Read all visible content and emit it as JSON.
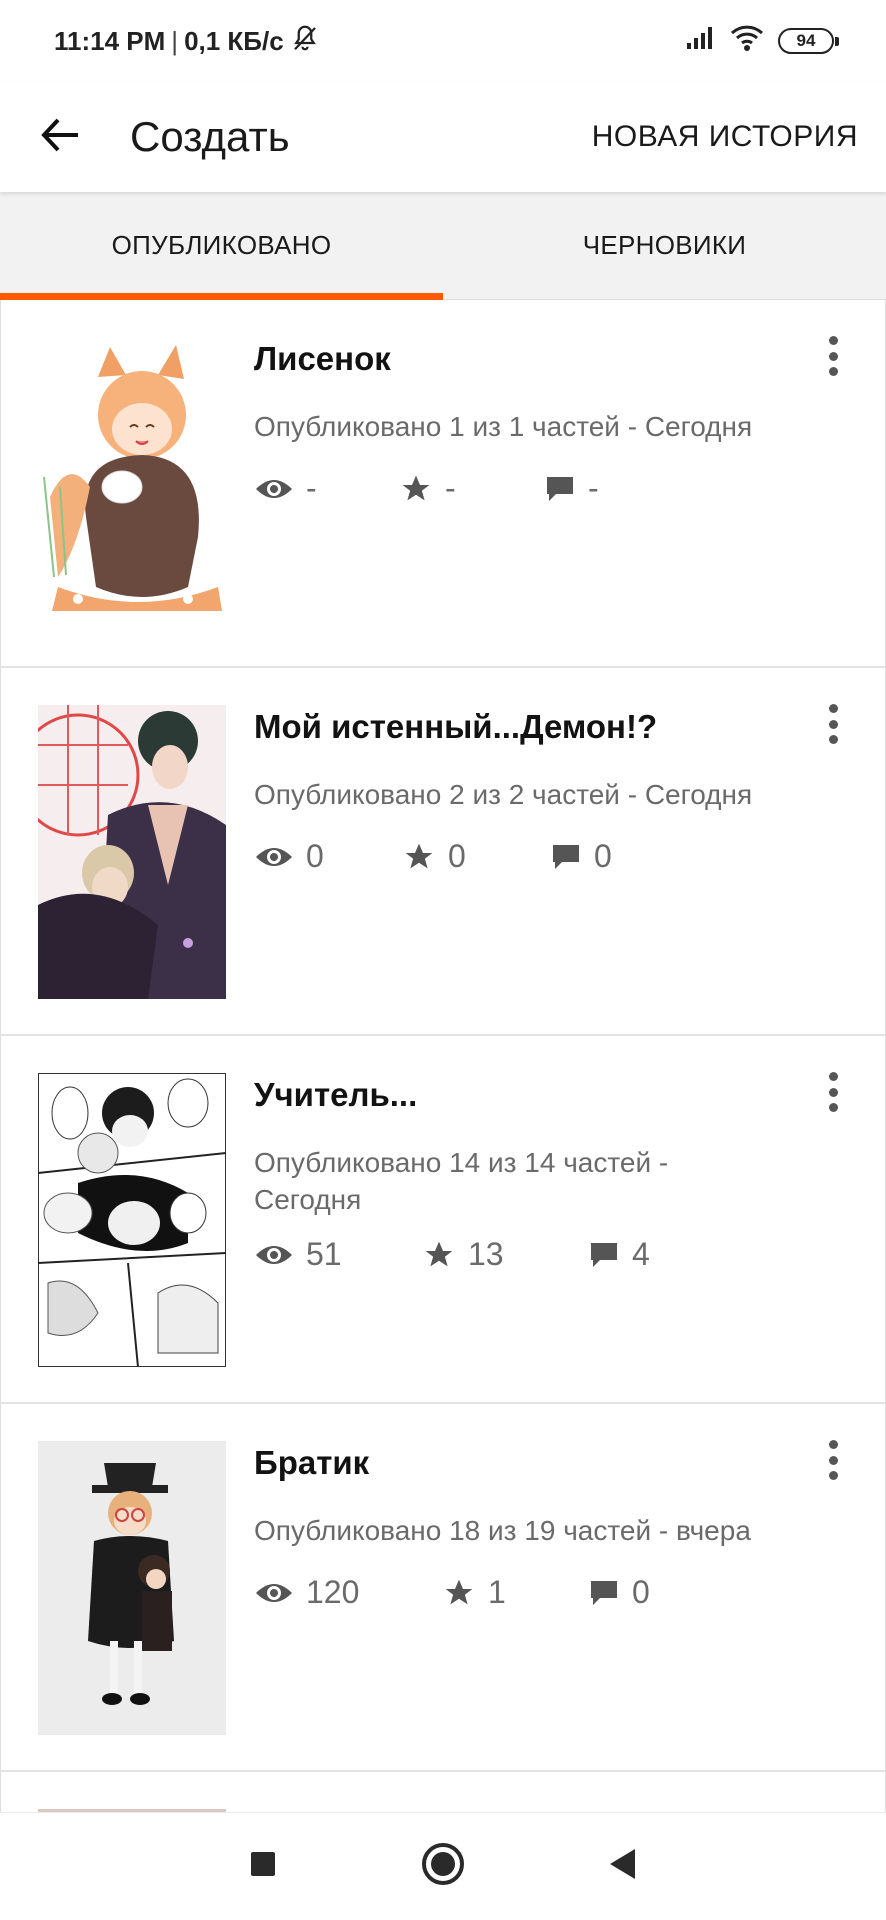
{
  "status_bar": {
    "time": "11:14 PM",
    "separator": "|",
    "speed": "0,1 КБ/с",
    "battery": "94",
    "icons": [
      "bell-off-icon",
      "signal-icon",
      "wifi-icon",
      "battery-icon"
    ]
  },
  "app_bar": {
    "title": "Создать",
    "new_story_label": "НОВАЯ ИСТОРИЯ",
    "back_icon": "arrow-left-icon"
  },
  "tabs": [
    {
      "label": "ОПУБЛИКОВАНО",
      "active": true
    },
    {
      "label": "ЧЕРНОВИКИ",
      "active": false
    }
  ],
  "colors": {
    "accent": "#ff5a00",
    "text_secondary": "#6a6a6a",
    "icon": "#555555"
  },
  "stories": [
    {
      "title": "Лисенок",
      "meta": "Опубликовано 1 из 1 частей - Сегодня",
      "views": "-",
      "votes": "-",
      "comments": "-"
    },
    {
      "title": "Мой истенный...Демон!?",
      "meta": "Опубликовано 2 из 2 частей - Сегодня",
      "views": "0",
      "votes": "0",
      "comments": "0"
    },
    {
      "title": "Учитель...",
      "meta": "Опубликовано 14 из 14 частей - Сегодня",
      "views": "51",
      "votes": "13",
      "comments": "4"
    },
    {
      "title": "Братик",
      "meta": "Опубликовано 18 из 19 частей - вчера",
      "views": "120",
      "votes": "1",
      "comments": "0"
    }
  ],
  "nav_bar": {
    "icons": [
      "recents-square-icon",
      "home-circle-icon",
      "back-triangle-icon"
    ]
  }
}
